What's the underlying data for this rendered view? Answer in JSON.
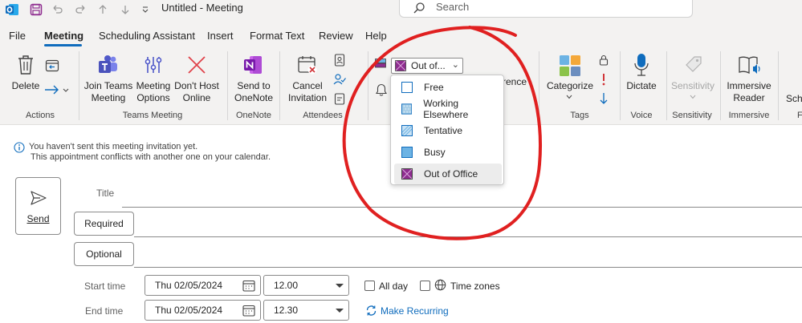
{
  "window": {
    "title": "Untitled - Meeting",
    "search_placeholder": "Search"
  },
  "titlebar_icons": [
    "outlook-icon",
    "save-icon",
    "undo-icon",
    "redo-icon",
    "up-arrow-icon",
    "down-arrow-icon",
    "customize-quick-access-icon"
  ],
  "menu": {
    "tabs": [
      {
        "label": "File",
        "active": false
      },
      {
        "label": "Meeting",
        "active": true
      },
      {
        "label": "Scheduling Assistant",
        "active": false
      },
      {
        "label": "Insert",
        "active": false
      },
      {
        "label": "Format Text",
        "active": false
      },
      {
        "label": "Review",
        "active": false
      },
      {
        "label": "Help",
        "active": false
      }
    ]
  },
  "ribbon": {
    "actions": {
      "delete": "Delete",
      "group": "Actions"
    },
    "teams": {
      "join_line1": "Join Teams",
      "join_line2": "Meeting",
      "options_line1": "Meeting",
      "options_line2": "Options",
      "donthost_line1": "Don't Host",
      "donthost_line2": "Online",
      "group": "Teams Meeting"
    },
    "onenote": {
      "line1": "Send to",
      "line2": "OneNote",
      "group": "OneNote"
    },
    "attendees": {
      "cancel_line1": "Cancel",
      "cancel_line2": "Invitation",
      "group": "Attendees"
    },
    "options": {
      "show_as_value": "Out of...",
      "partial_text": "rrence"
    },
    "tags": {
      "categorize": "Categorize",
      "group": "Tags"
    },
    "voice": {
      "dictate": "Dictate",
      "group": "Voice"
    },
    "sensitivity": {
      "label": "Sensitivity",
      "group": "Sensitivity"
    },
    "immersive": {
      "line1": "Immersive",
      "line2": "Reader",
      "group": "Immersive"
    },
    "cut_off": {
      "label": "Sch",
      "group": "F"
    }
  },
  "show_as_menu": {
    "selected": "Out of Office",
    "items": [
      {
        "label": "Free",
        "color": "#ffffff"
      },
      {
        "label": "Working Elsewhere",
        "color": "#a9cfe8"
      },
      {
        "label": "Tentative",
        "color": "#c9e2f4"
      },
      {
        "label": "Busy",
        "color": "#6cb3e4"
      },
      {
        "label": "Out of Office",
        "color": "#8e2c8f"
      }
    ]
  },
  "info": {
    "line1": "You haven't sent this meeting invitation yet.",
    "line2": "This appointment conflicts with another one on your calendar."
  },
  "form": {
    "send": "Send",
    "title_label": "Title",
    "required": "Required",
    "optional": "Optional",
    "start_label": "Start time",
    "end_label": "End time",
    "start_date": "Thu 02/05/2024",
    "start_time": "12.00",
    "end_date": "Thu 02/05/2024",
    "end_time": "12.30",
    "all_day": "All day",
    "time_zones": "Time zones",
    "make_recurring": "Make Recurring"
  },
  "colors": {
    "accent": "#0f6cbd",
    "annotation_red": "#e02020",
    "out_of_office": "#8e2c8f"
  }
}
